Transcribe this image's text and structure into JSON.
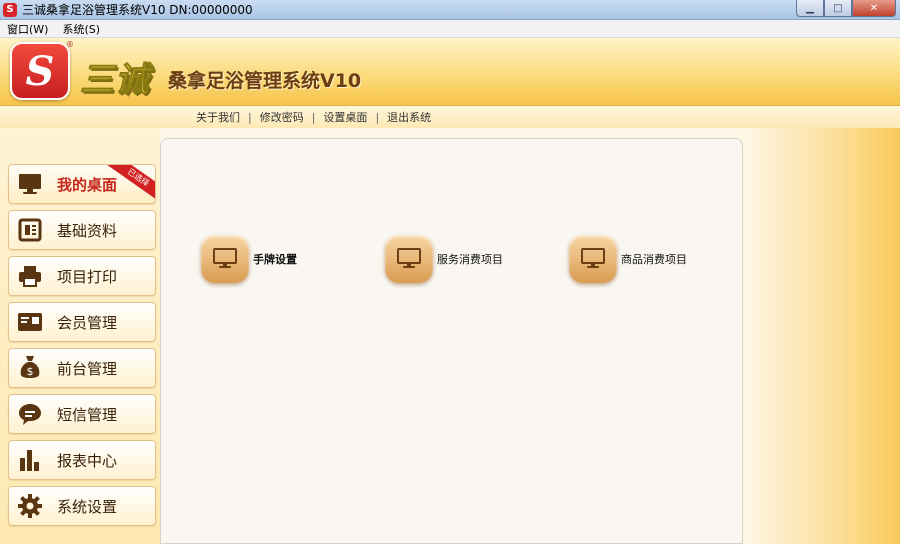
{
  "window": {
    "title": "三诚桑拿足浴管理系统V10 DN:00000000",
    "logo_letter": "S",
    "minimize_glyph": "▁",
    "maximize_glyph": "□",
    "close_glyph": "✕"
  },
  "menu": [
    {
      "label": "窗口(W)"
    },
    {
      "label": "系统(S)"
    }
  ],
  "header": {
    "logo_letter": "S",
    "registered_mark": "®",
    "brand": "三诚",
    "subtitle": "桑拿足浴管理系统V10"
  },
  "topnav": {
    "items": [
      "关于我们",
      "修改密码",
      "设置桌面",
      "退出系统"
    ],
    "separator": "|"
  },
  "sidebar": {
    "items": [
      {
        "label": "我的桌面",
        "icon": "monitor-icon",
        "active": true,
        "ribbon": "已选择"
      },
      {
        "label": "基础资料",
        "icon": "document-icon"
      },
      {
        "label": "项目打印",
        "icon": "printer-icon"
      },
      {
        "label": "会员管理",
        "icon": "card-icon"
      },
      {
        "label": "前台管理",
        "icon": "money-bag-icon"
      },
      {
        "label": "短信管理",
        "icon": "chat-bubble-icon"
      },
      {
        "label": "报表中心",
        "icon": "bar-chart-icon"
      },
      {
        "label": "系统设置",
        "icon": "gear-icon"
      }
    ]
  },
  "desktop": {
    "tiles": [
      {
        "label": "手牌设置",
        "icon": "monitor-icon"
      },
      {
        "label": "服务消费项目",
        "icon": "monitor-icon"
      },
      {
        "label": "商品消费项目",
        "icon": "monitor-icon"
      }
    ]
  },
  "colors": {
    "accent_red": "#c4261a",
    "icon_brown": "#5a3511",
    "tile_orange": "#d99b4f"
  }
}
